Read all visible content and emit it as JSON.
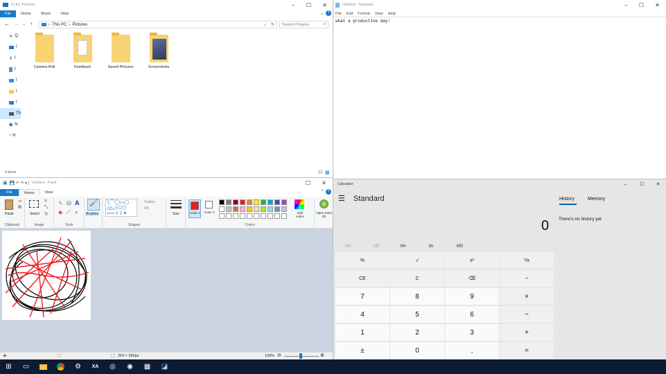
{
  "explorer": {
    "title": "Pictures",
    "ribbon_tabs": [
      "File",
      "Home",
      "Share",
      "View"
    ],
    "breadcrumb": [
      "This PC",
      "Pictures"
    ],
    "search_placeholder": "Search Pictures",
    "side_labels": [
      "Q",
      "I",
      "I",
      "I",
      "I",
      "I",
      "I",
      "Th",
      "N",
      "H"
    ],
    "folders": [
      "Camera Roll",
      "Feedback",
      "Saved Pictures",
      "Screenshots"
    ],
    "status": "4 items"
  },
  "notepad": {
    "title": "Untitled - Notepad",
    "menu": [
      "File",
      "Edit",
      "Format",
      "View",
      "Help"
    ],
    "content": "what a productive day!"
  },
  "paint": {
    "title": "Untitled - Paint",
    "ribbon_tabs": [
      "File",
      "Home",
      "View"
    ],
    "groups": {
      "clipboard": "Clipboard",
      "image": "Image",
      "tools": "Tools",
      "shapes": "Shapes",
      "colors": "Colors"
    },
    "buttons": {
      "paste": "Paste",
      "select": "Select",
      "brushes": "Brushes",
      "outline": "Outline",
      "fill": "Fill",
      "size": "Size",
      "color1": "Color 1",
      "color2": "Color 2",
      "edit_colors": "Edit colors",
      "open_paint3d": "Open Paint 3D"
    },
    "palette_row1": [
      "#000000",
      "#7f7f7f",
      "#880015",
      "#ed1c24",
      "#ff7f27",
      "#fff200",
      "#22b14c",
      "#00a2e8",
      "#3f48cc",
      "#a349a4"
    ],
    "palette_row2": [
      "#ffffff",
      "#c3c3c3",
      "#b97a57",
      "#ffaec9",
      "#ffc90e",
      "#efe4b0",
      "#b5e61d",
      "#99d9ea",
      "#7092be",
      "#c8bfe7"
    ],
    "color1": "#ed1c24",
    "color2": "#ffffff",
    "dimensions": "254 × 260px",
    "zoom": "100%"
  },
  "calculator": {
    "title": "Calculator",
    "mode": "Standard",
    "display": "0",
    "tabs": [
      "History",
      "Memory"
    ],
    "history_empty": "There's no history yet",
    "memory_buttons": [
      "MC",
      "MR",
      "M+",
      "M-",
      "MS"
    ],
    "keys": [
      [
        "%",
        "√",
        "x²",
        "¹/x"
      ],
      [
        "CE",
        "C",
        "⌫",
        "÷"
      ],
      [
        "7",
        "8",
        "9",
        "×"
      ],
      [
        "4",
        "5",
        "6",
        "−"
      ],
      [
        "1",
        "2",
        "3",
        "+"
      ],
      [
        "±",
        "0",
        ",",
        "="
      ]
    ]
  },
  "taskbar": {
    "icons": [
      "windows-start-icon",
      "task-view-icon",
      "file-explorer-icon",
      "chrome-icon",
      "steam-icon",
      "app-icon",
      "browser-icon",
      "network-icon",
      "calculator-icon",
      "paint-icon"
    ]
  }
}
